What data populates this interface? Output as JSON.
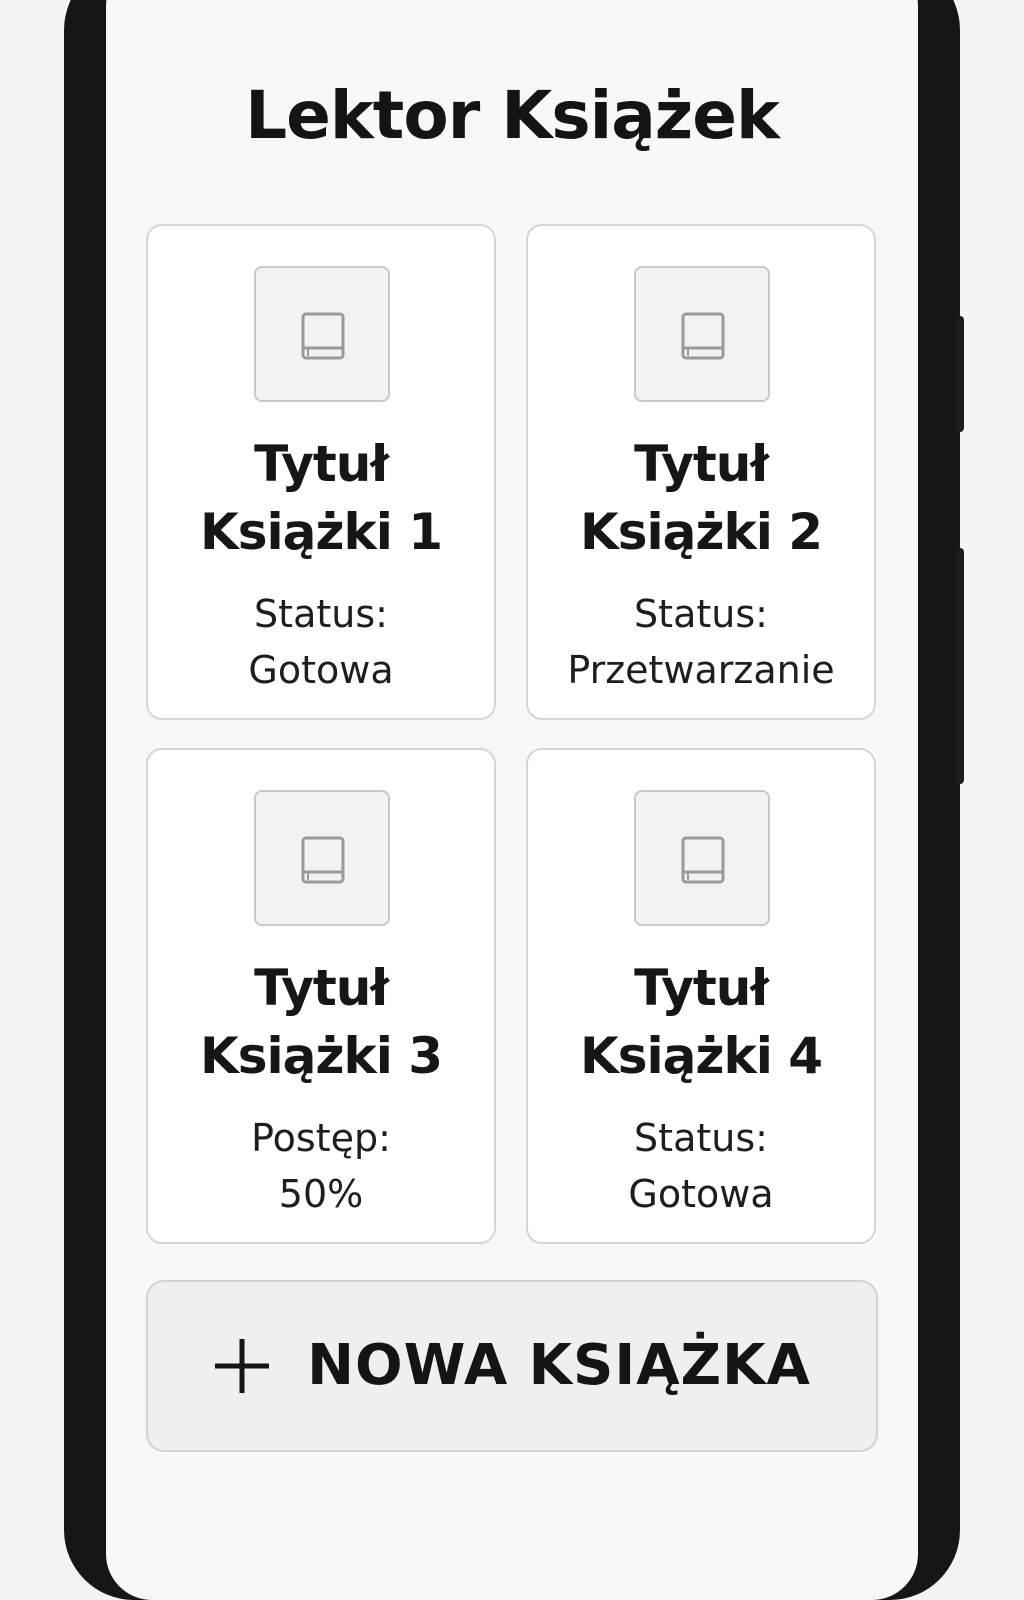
{
  "app": {
    "title": "Lektor Książek"
  },
  "books": [
    {
      "title_line1": "Tytuł",
      "title_line2": "Książki 1",
      "status_line1": "Status:",
      "status_line2": "Gotowa",
      "icon": "book-icon"
    },
    {
      "title_line1": "Tytuł",
      "title_line2": "Książki 2",
      "status_line1": "Status:",
      "status_line2": "Przetwarzanie",
      "icon": "book-icon"
    },
    {
      "title_line1": "Tytuł",
      "title_line2": "Książki 3",
      "status_line1": "Postęp:",
      "status_line2": "50%",
      "icon": "book-icon"
    },
    {
      "title_line1": "Tytuł",
      "title_line2": "Książki 4",
      "status_line1": "Status:",
      "status_line2": "Gotowa",
      "icon": "book-icon"
    }
  ],
  "new_book_button": {
    "label": "NOWA KSIĄŻKA",
    "icon": "plus-icon"
  }
}
